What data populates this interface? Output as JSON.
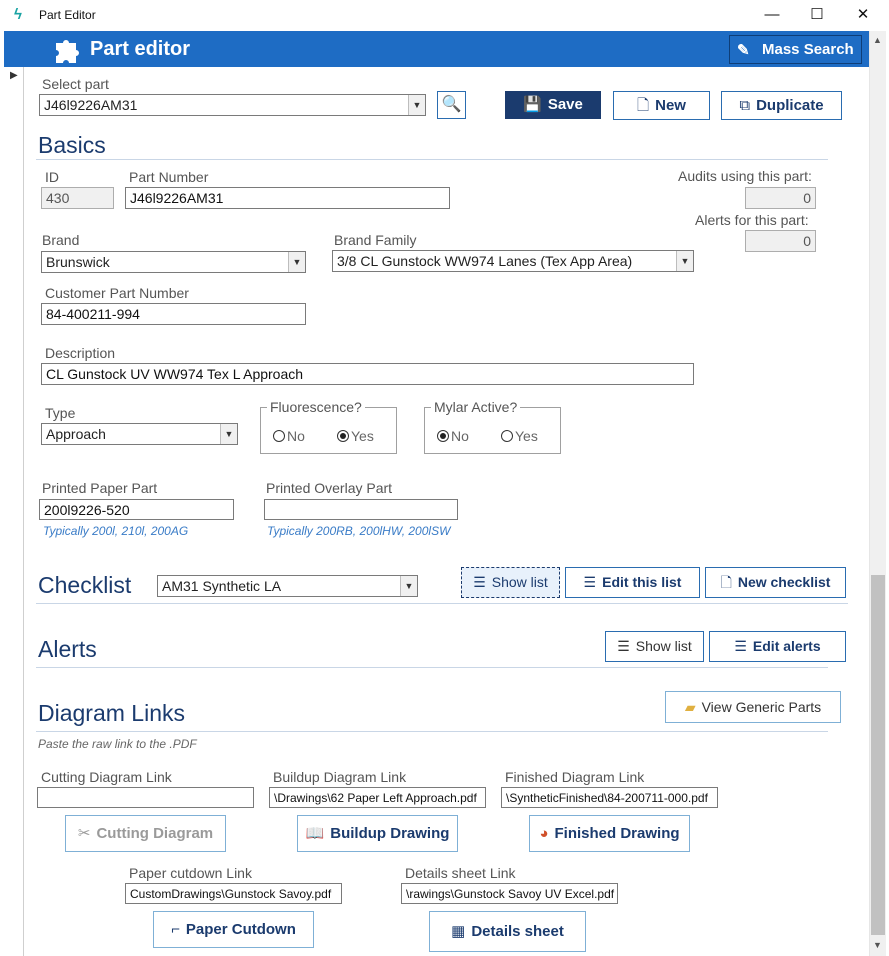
{
  "window": {
    "title": "Part Editor",
    "minimize": "—",
    "maximize": "☐",
    "close": "✕"
  },
  "header": {
    "title": "Part editor",
    "mass_search": "Mass Search"
  },
  "select_part": {
    "label": "Select part",
    "value": "J46l9226AM31"
  },
  "toolbar": {
    "save": "Save",
    "new": "New",
    "duplicate": "Duplicate"
  },
  "basics": {
    "heading": "Basics",
    "id_label": "ID",
    "id_value": "430",
    "part_number_label": "Part Number",
    "part_number_value": "J46l9226AM31",
    "audits_label": "Audits using this part:",
    "audits_value": "0",
    "alerts_label": "Alerts for this part:",
    "alerts_value": "0",
    "brand_label": "Brand",
    "brand_value": "Brunswick",
    "brand_family_label": "Brand Family",
    "brand_family_value": "3/8 CL Gunstock WW974 Lanes (Tex App Area)",
    "customer_pn_label": "Customer Part Number",
    "customer_pn_value": "84-400211-994",
    "description_label": "Description",
    "description_value": "CL Gunstock UV WW974 Tex L Approach",
    "type_label": "Type",
    "type_value": "Approach",
    "fluorescence_label": "Fluorescence?",
    "fluor_no": "No",
    "fluor_yes": "Yes",
    "mylar_label": "Mylar Active?",
    "mylar_no": "No",
    "mylar_yes": "Yes",
    "printed_paper_label": "Printed Paper Part",
    "printed_paper_value": "200l9226-520",
    "printed_paper_hint": "Typically 200l, 210l, 200AG",
    "printed_overlay_label": "Printed Overlay Part",
    "printed_overlay_value": "",
    "printed_overlay_hint": "Typically 200RB, 200lHW, 200lSW"
  },
  "checklist": {
    "heading": "Checklist",
    "value": "AM31 Synthetic LA",
    "show_list": "Show list",
    "edit_list": "Edit this list",
    "new_checklist": "New checklist"
  },
  "alerts": {
    "heading": "Alerts",
    "show_list": "Show list",
    "edit_alerts": "Edit alerts"
  },
  "diagrams": {
    "heading": "Diagram Links",
    "view_generic": "View Generic Parts",
    "hint": "Paste the raw link to the .PDF",
    "cutting_label": "Cutting Diagram Link",
    "cutting_value": "",
    "buildup_label": "Buildup Diagram Link",
    "buildup_value": "\\Drawings\\62 Paper Left Approach.pdf",
    "finished_label": "Finished Diagram Link",
    "finished_value": "\\SyntheticFinished\\84-200711-000.pdf",
    "cutting_btn": "Cutting Diagram",
    "buildup_btn": "Buildup Drawing",
    "finished_btn": "Finished Drawing",
    "paper_label": "Paper cutdown Link",
    "paper_value": "CustomDrawings\\Gunstock Savoy.pdf",
    "details_label": "Details sheet Link",
    "details_value": "\\rawings\\Gunstock Savoy UV Excel.pdf",
    "paper_btn": "Paper Cutdown",
    "details_btn": "Details sheet"
  }
}
